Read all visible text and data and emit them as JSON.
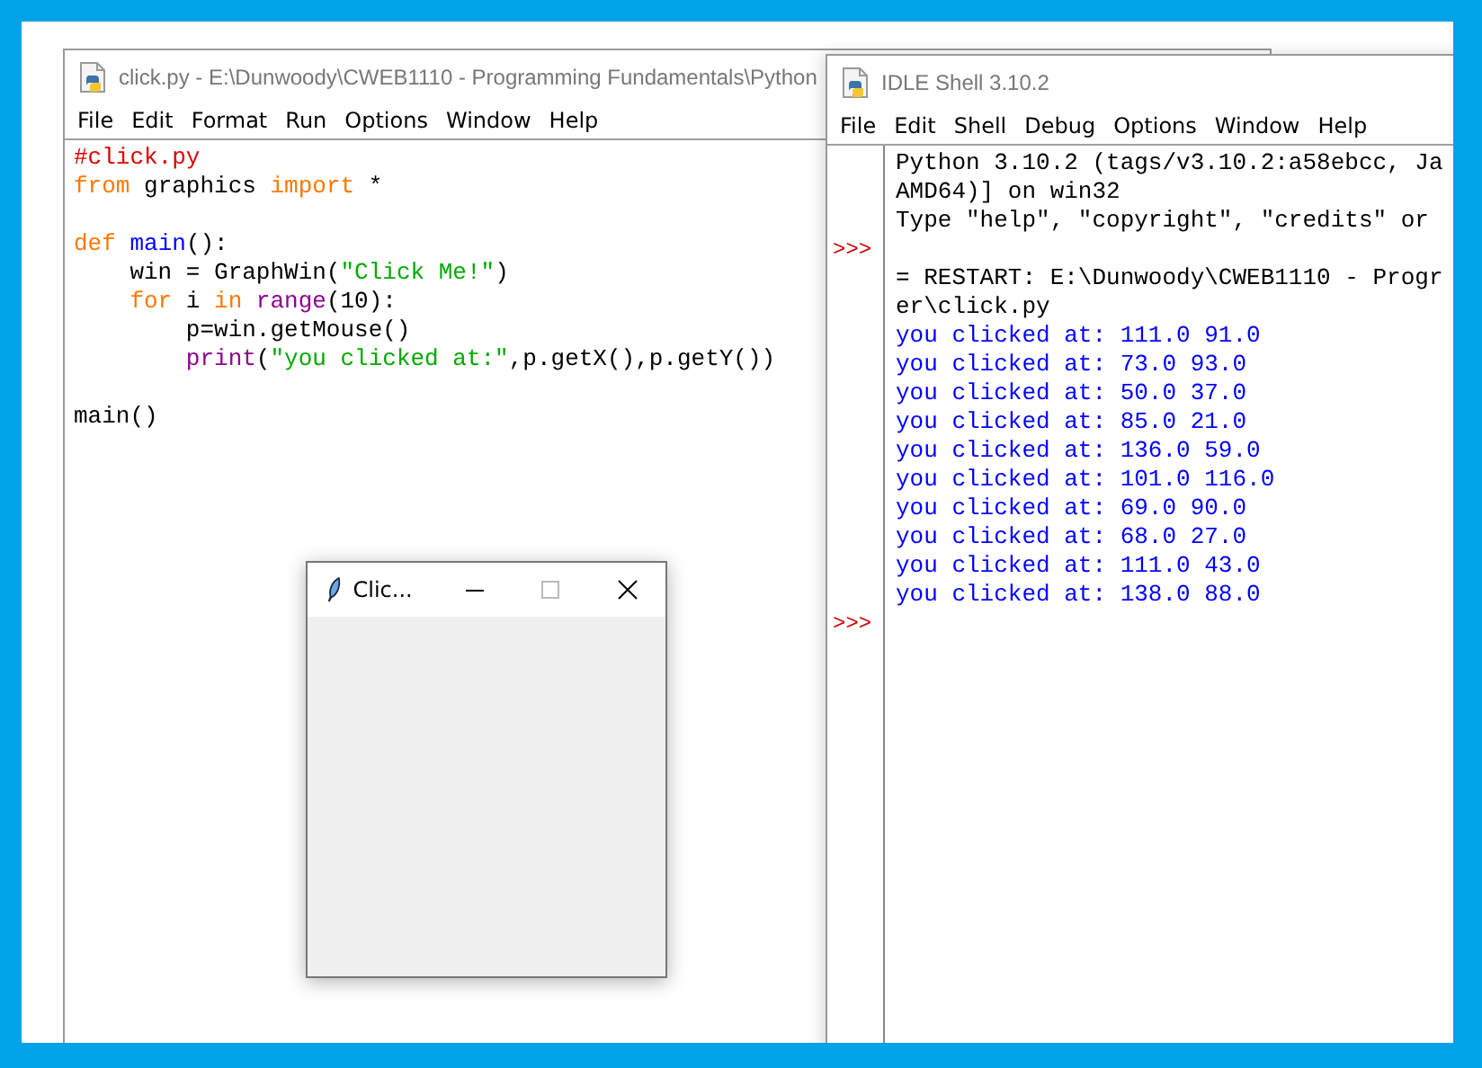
{
  "editor": {
    "title": "click.py - E:\\Dunwoody\\CWEB1110 - Programming Fundamentals\\Python",
    "menu": [
      "File",
      "Edit",
      "Format",
      "Run",
      "Options",
      "Window",
      "Help"
    ],
    "code": [
      {
        "kind": "code",
        "tokens": [
          {
            "kind": "comment",
            "text": "#click.py"
          }
        ]
      },
      {
        "kind": "code",
        "tokens": [
          {
            "kind": "keyword",
            "text": "from"
          },
          {
            "kind": "plain",
            "text": " graphics "
          },
          {
            "kind": "keyword",
            "text": "import"
          },
          {
            "kind": "plain",
            "text": " *"
          }
        ]
      },
      {
        "kind": "blank"
      },
      {
        "kind": "code",
        "tokens": [
          {
            "kind": "keyword",
            "text": "def "
          },
          {
            "kind": "definition",
            "text": "main"
          },
          {
            "kind": "plain",
            "text": "():"
          }
        ]
      },
      {
        "kind": "code",
        "tokens": [
          {
            "kind": "plain",
            "text": "    win = GraphWin("
          },
          {
            "kind": "string",
            "text": "\"Click Me!\""
          },
          {
            "kind": "plain",
            "text": ")"
          }
        ]
      },
      {
        "kind": "code",
        "tokens": [
          {
            "kind": "keyword",
            "text": "    for"
          },
          {
            "kind": "plain",
            "text": " i "
          },
          {
            "kind": "keyword",
            "text": "in"
          },
          {
            "kind": "builtin",
            "text": " range"
          },
          {
            "kind": "plain",
            "text": "(10):"
          }
        ]
      },
      {
        "kind": "code",
        "tokens": [
          {
            "kind": "plain",
            "text": "        p=win.getMouse()"
          }
        ]
      },
      {
        "kind": "code",
        "tokens": [
          {
            "kind": "builtin",
            "text": "        print"
          },
          {
            "kind": "plain",
            "text": "("
          },
          {
            "kind": "string",
            "text": "\"you clicked at:\""
          },
          {
            "kind": "plain",
            "text": ",p.getX(),p.getY())"
          }
        ]
      },
      {
        "kind": "blank"
      },
      {
        "kind": "code",
        "tokens": [
          {
            "kind": "plain",
            "text": "main()"
          }
        ]
      }
    ]
  },
  "shell": {
    "title": "IDLE Shell 3.10.2",
    "menu": [
      "File",
      "Edit",
      "Shell",
      "Debug",
      "Options",
      "Window",
      "Help"
    ],
    "lines": [
      {
        "kind": "banner",
        "text": "Python 3.10.2 (tags/v3.10.2:a58ebcc, Ja"
      },
      {
        "kind": "banner",
        "text": "AMD64)] on win32"
      },
      {
        "kind": "banner",
        "text": "Type \"help\", \"copyright\", \"credits\" or"
      },
      {
        "kind": "blank",
        "prompt": ">>>"
      },
      {
        "kind": "banner",
        "text": "= RESTART: E:\\Dunwoody\\CWEB1110 - Progr"
      },
      {
        "kind": "banner",
        "text": "er\\click.py"
      },
      {
        "kind": "output",
        "text": "you clicked at: 111.0 91.0"
      },
      {
        "kind": "output",
        "text": "you clicked at: 73.0 93.0"
      },
      {
        "kind": "output",
        "text": "you clicked at: 50.0 37.0"
      },
      {
        "kind": "output",
        "text": "you clicked at: 85.0 21.0"
      },
      {
        "kind": "output",
        "text": "you clicked at: 136.0 59.0"
      },
      {
        "kind": "output",
        "text": "you clicked at: 101.0 116.0"
      },
      {
        "kind": "output",
        "text": "you clicked at: 69.0 90.0"
      },
      {
        "kind": "output",
        "text": "you clicked at: 68.0 27.0"
      },
      {
        "kind": "output",
        "text": "you clicked at: 111.0 43.0"
      },
      {
        "kind": "output",
        "text": "you clicked at: 138.0 88.0"
      },
      {
        "kind": "blank",
        "prompt": ">>>"
      }
    ]
  },
  "graph_window": {
    "title": "Clic..."
  }
}
